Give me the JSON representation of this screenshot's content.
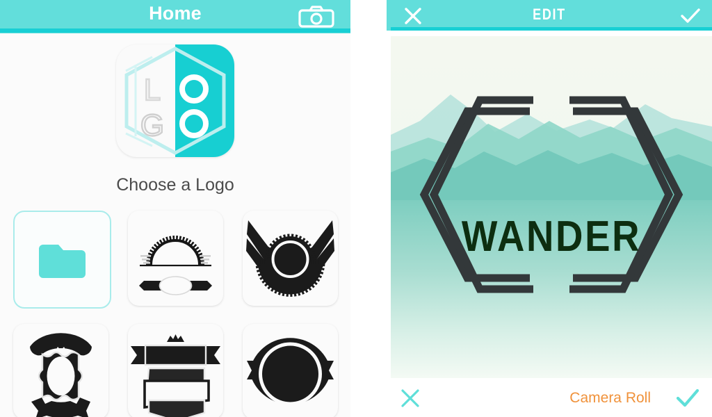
{
  "left_panel": {
    "header": {
      "title": "Home",
      "camera_icon": "camera-icon",
      "background_color": "#62dedb",
      "underline_color": "#18cfd4"
    },
    "app_icon": {
      "letters": [
        "L",
        "O",
        "G",
        "O"
      ],
      "accent_color": "#17cfd2",
      "alt": "logo-app-icon"
    },
    "choose_label": "Choose a Logo",
    "logo_grid": [
      {
        "name": "folder-picker",
        "icon": "folder-icon",
        "selected": true,
        "accent_color": "#5fdfd9"
      },
      {
        "name": "arch-banner-logo",
        "icon": "arch-gear-banner",
        "selected": false
      },
      {
        "name": "winged-gear-logo",
        "icon": "wings-gear-emblem",
        "selected": false
      },
      {
        "name": "crest-shield-logo",
        "icon": "crown-shield-crest",
        "selected": false
      },
      {
        "name": "ribbon-stack-logo",
        "icon": "crown-banner-stack",
        "selected": false
      },
      {
        "name": "circle-ribbon-logo",
        "icon": "circle-ring-ribbon",
        "selected": false
      }
    ]
  },
  "right_panel": {
    "header": {
      "title": "EDIT",
      "close_icon": "close-x-icon",
      "confirm_icon": "check-icon",
      "background_color": "#62dedb",
      "underline_color": "#18cfd4"
    },
    "photo": {
      "alt": "mountain-landscape-photo",
      "overlay_text": "WANDER",
      "overlay_text_color": "#0d2e10",
      "frame": "double-hexagon-bracket",
      "frame_color": "#33383a"
    },
    "footer": {
      "close_icon": "close-x-icon",
      "close_color": "#5fdfd9",
      "source_label": "Camera Roll",
      "source_color": "#f0923b",
      "confirm_icon": "check-icon",
      "confirm_color": "#5fdfd9"
    }
  }
}
